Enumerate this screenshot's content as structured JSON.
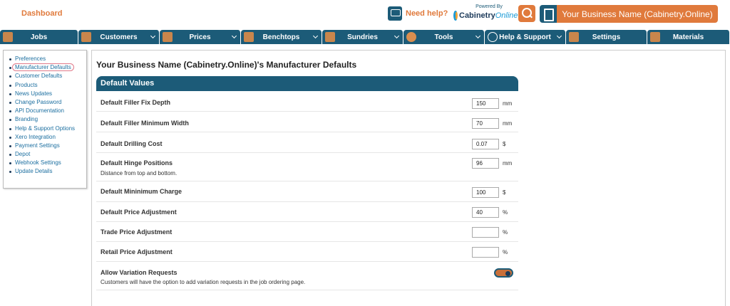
{
  "header": {
    "dashboard_label": "Dashboard",
    "need_help_label": "Need help?",
    "powered_by_label": "Powered By",
    "logo_main": "Cabinetry",
    "logo_sub": "Online",
    "business_name": "Your Business Name (Cabinetry.Online)"
  },
  "nav": {
    "items": [
      {
        "label": "Jobs",
        "icon": "layers-icon",
        "dropdown": false
      },
      {
        "label": "Customers",
        "icon": "user-icon",
        "dropdown": true
      },
      {
        "label": "Prices",
        "icon": "price-tag-icon",
        "dropdown": true
      },
      {
        "label": "Benchtops",
        "icon": "benchtop-icon",
        "dropdown": true
      },
      {
        "label": "Sundries",
        "icon": "sundries-icon",
        "dropdown": true
      },
      {
        "label": "Tools",
        "icon": "gear-icon",
        "dropdown": true
      },
      {
        "label": "Help & Support",
        "icon": "chat-bubble-icon",
        "dropdown": true
      },
      {
        "label": "Settings",
        "icon": "settings-icon",
        "dropdown": false
      },
      {
        "label": "Materials",
        "icon": "materials-icon",
        "dropdown": false
      }
    ]
  },
  "sidebar": {
    "items": [
      {
        "label": "Preferences",
        "active": false
      },
      {
        "label": "Manufacturer Defaults",
        "active": true
      },
      {
        "label": "Customer Defaults",
        "active": false
      },
      {
        "label": "Products",
        "active": false
      },
      {
        "label": "News Updates",
        "active": false
      },
      {
        "label": "Change Password",
        "active": false
      },
      {
        "label": "API Documentation",
        "active": false
      },
      {
        "label": "Branding",
        "active": false
      },
      {
        "label": "Help & Support Options",
        "active": false
      },
      {
        "label": "Xero Integration",
        "active": false
      },
      {
        "label": "Payment Settings",
        "active": false
      },
      {
        "label": "Depot",
        "active": false
      },
      {
        "label": "Webhook Settings",
        "active": false
      },
      {
        "label": "Update Details",
        "active": false
      }
    ]
  },
  "main": {
    "title": "Your Business Name (Cabinetry.Online)'s Manufacturer Defaults",
    "section_title": "Default Values",
    "rows": [
      {
        "label": "Default Filler Fix Depth",
        "value": "150",
        "unit": "mm"
      },
      {
        "label": "Default Filler Minimum Width",
        "value": "70",
        "unit": "mm"
      },
      {
        "label": "Default Drilling Cost",
        "value": "0.07",
        "unit": "$"
      },
      {
        "label": "Default Hinge Positions",
        "sub": "Distance from top and bottom.",
        "value": "96",
        "unit": "mm"
      },
      {
        "label": "Default Mininimum Charge",
        "value": "100",
        "unit": "$"
      },
      {
        "label": "Default Price Adjustment",
        "value": "40",
        "unit": "%"
      },
      {
        "label": "Trade Price Adjustment",
        "value": "",
        "unit": "%"
      },
      {
        "label": "Retail Price Adjustment",
        "value": "",
        "unit": "%"
      }
    ],
    "toggle_row": {
      "label": "Allow Variation Requests",
      "sub": "Customers will have the option to add variation requests in the job ordering page.",
      "enabled": true
    }
  },
  "colors": {
    "primary": "#1c5b78",
    "accent": "#e07a3c"
  }
}
